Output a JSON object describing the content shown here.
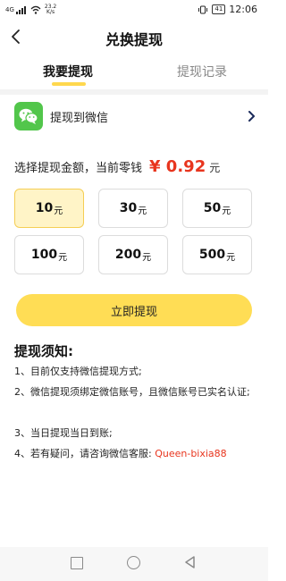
{
  "status_bar": {
    "network": "4G",
    "speed_value": "23.2",
    "speed_unit": "K/s",
    "battery": "41",
    "time": "12:06"
  },
  "header": {
    "title": "兑换提现"
  },
  "tabs": [
    {
      "label": "我要提现",
      "active": true
    },
    {
      "label": "提现记录",
      "active": false
    }
  ],
  "method": {
    "label": "提现到微信",
    "icon": "wechat-icon"
  },
  "amount_section": {
    "prompt": "选择提现金额，当前零钱",
    "balance": "¥ 0.92",
    "unit": "元"
  },
  "amount_options": [
    {
      "value": "10",
      "unit": "元",
      "selected": true
    },
    {
      "value": "30",
      "unit": "元",
      "selected": false
    },
    {
      "value": "50",
      "unit": "元",
      "selected": false
    },
    {
      "value": "100",
      "unit": "元",
      "selected": false
    },
    {
      "value": "200",
      "unit": "元",
      "selected": false
    },
    {
      "value": "500",
      "unit": "元",
      "selected": false
    }
  ],
  "withdraw_button": {
    "label": "立即提现"
  },
  "notice": {
    "title": "提现须知:",
    "items": [
      "1、目前仅支持微信提现方式;",
      "2、微信提现须绑定微信账号，且微信账号已实名认证;",
      "3、当日提现当日到账;",
      "4、若有疑问，请咨询微信客服:"
    ],
    "support_id": "Queen-bixia88"
  },
  "colors": {
    "accent_yellow": "#FFDD55",
    "selected_fill": "#FFF4C7",
    "price_red": "#E8351E",
    "wechat_green": "#52C64B"
  }
}
